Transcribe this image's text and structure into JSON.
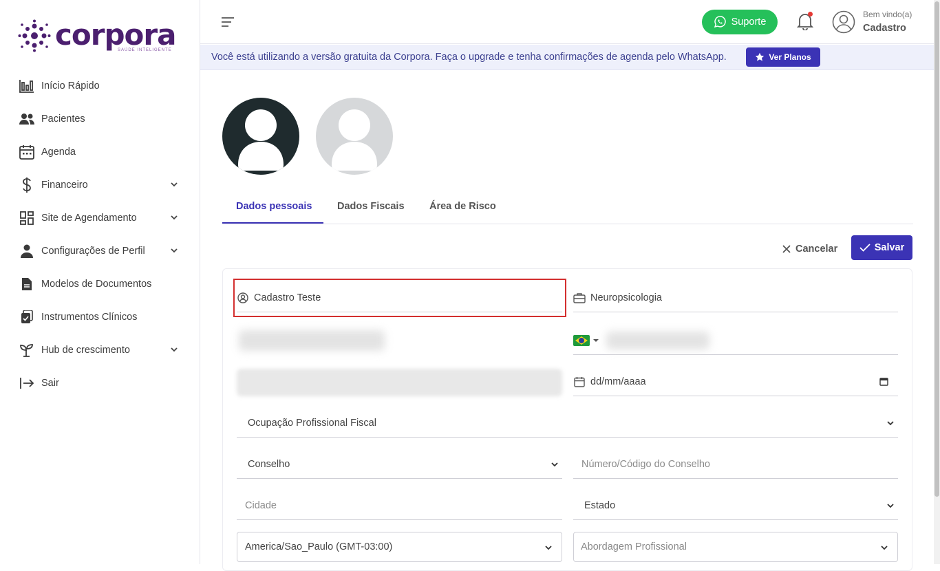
{
  "brand": {
    "name": "corpora",
    "tagline": "SAÚDE INTELIGENTE",
    "color": "#4b1f6f"
  },
  "sidebar": {
    "items": [
      {
        "label": "Início Rápido",
        "icon": "chart-bars-icon",
        "has_submenu": false
      },
      {
        "label": "Pacientes",
        "icon": "users-icon",
        "has_submenu": false
      },
      {
        "label": "Agenda",
        "icon": "calendar-icon",
        "has_submenu": false
      },
      {
        "label": "Financeiro",
        "icon": "dollar-icon",
        "has_submenu": true
      },
      {
        "label": "Site de Agendamento",
        "icon": "dashboard-grid-icon",
        "has_submenu": true
      },
      {
        "label": "Configurações de Perfil",
        "icon": "person-icon",
        "has_submenu": true
      },
      {
        "label": "Modelos de Documentos",
        "icon": "document-icon",
        "has_submenu": false
      },
      {
        "label": "Instrumentos Clínicos",
        "icon": "clipboard-check-icon",
        "has_submenu": false
      },
      {
        "label": "Hub de crescimento",
        "icon": "sprout-icon",
        "has_submenu": true
      },
      {
        "label": "Sair",
        "icon": "logout-icon",
        "has_submenu": false
      }
    ]
  },
  "header": {
    "support_label": "Suporte",
    "welcome": "Bem vindo(a)",
    "user_name": "Cadastro",
    "notification_dot": true
  },
  "banner": {
    "text": "Você está utilizando a versão gratuita da Corpora. Faça o upgrade e tenha confirmações de agenda pelo WhatsApp.",
    "button_label": "Ver Planos"
  },
  "tabs": [
    {
      "label": "Dados pessoais",
      "active": true
    },
    {
      "label": "Dados Fiscais",
      "active": false
    },
    {
      "label": "Área de Risco",
      "active": false
    }
  ],
  "actions": {
    "cancel_label": "Cancelar",
    "save_label": "Salvar"
  },
  "form": {
    "name_value": "Cadastro Teste",
    "specialty_value": "Neuropsicologia",
    "birthdate_placeholder": "dd/mm/aaaa",
    "occupation_select": "Ocupação Profissional Fiscal",
    "council_select": "Conselho",
    "council_number_placeholder": "Número/Código do Conselho",
    "city_placeholder": "Cidade",
    "state_select": "Estado",
    "timezone_select": "America/Sao_Paulo (GMT-03:00)",
    "approach_placeholder": "Abordagem Profissional"
  },
  "colors": {
    "primary": "#3b33b5",
    "support_green": "#25c05a",
    "highlight_red": "#d32f2f",
    "banner_bg": "#eef0fb"
  }
}
